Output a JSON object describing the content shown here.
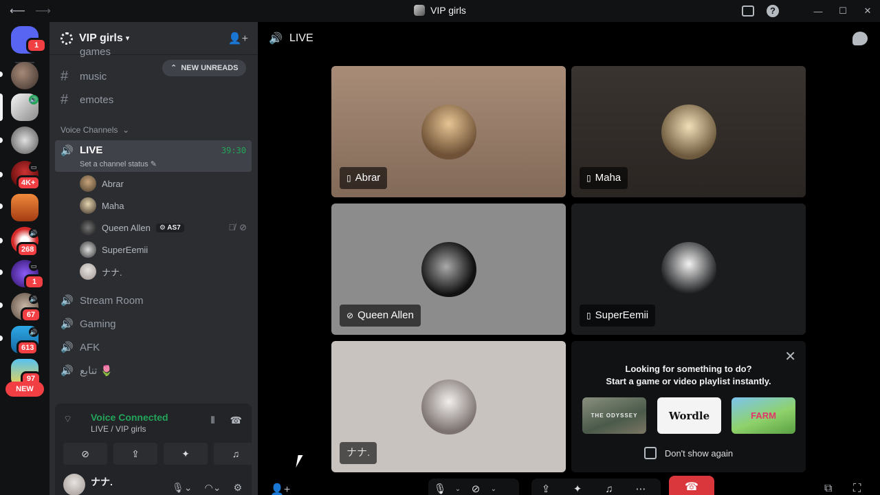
{
  "window": {
    "title": "VIP girls"
  },
  "rail": {
    "badges": [
      "1",
      "4K+",
      "268",
      "1",
      "67",
      "613",
      "97"
    ],
    "new_label": "NEW"
  },
  "server": {
    "name": "VIP girls"
  },
  "channels": {
    "text": [
      "games",
      "music",
      "emotes"
    ],
    "new_unreads": "NEW UNREADS",
    "voice_category": "Voice Channels",
    "live": {
      "name": "LIVE",
      "timer": "39:30",
      "status": "Set a channel status"
    },
    "members": [
      {
        "name": "Abrar"
      },
      {
        "name": "Maha"
      },
      {
        "name": "Queen Allen",
        "tag": "AS7"
      },
      {
        "name": "SuperEemii"
      },
      {
        "name": "ナナ."
      }
    ],
    "voice": [
      "Stream Room",
      "Gaming",
      "AFK",
      "تنابع 🌷"
    ]
  },
  "voice_panel": {
    "status": "Voice Connected",
    "location": "LIVE / VIP girls"
  },
  "user": {
    "name": "ナナ."
  },
  "main": {
    "channel": "LIVE",
    "tiles": [
      {
        "name": "Abrar",
        "device": "phone"
      },
      {
        "name": "Maha",
        "device": "phone"
      },
      {
        "name": "Queen Allen",
        "device": "camera-off"
      },
      {
        "name": "SuperEemii",
        "device": "phone"
      },
      {
        "name": "ナナ.",
        "device": ""
      }
    ],
    "activity": {
      "line1": "Looking for something to do?",
      "line2": "Start a game or video playlist instantly.",
      "games": [
        "THE ODYSSEY",
        "Wordle",
        "FARM"
      ],
      "dont_show": "Don't show again"
    }
  },
  "colors": {
    "accent_green": "#23a55a",
    "danger_red": "#da373c",
    "badge_red": "#f23f43"
  }
}
